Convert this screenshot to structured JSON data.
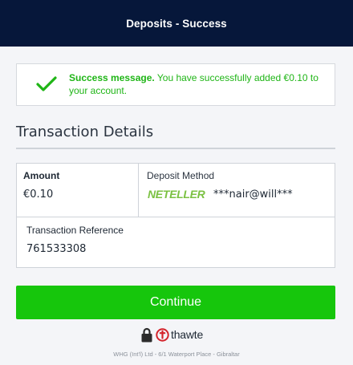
{
  "header": {
    "title": "Deposits - Success"
  },
  "success": {
    "lead": "Success message.",
    "message": " You have successfully added €0.10 to your account.",
    "icon": "check-icon",
    "color": "#1fb516"
  },
  "details": {
    "title": "Transaction Details",
    "amount_label": "Amount",
    "amount_value": "€0.10",
    "method_label": "Deposit Method",
    "method_logo": "NETELLER",
    "method_account": "***nair@will***",
    "ref_label": "Transaction Reference",
    "ref_value": "761533308"
  },
  "actions": {
    "continue_label": "Continue",
    "continue_color": "#16c60c"
  },
  "trust": {
    "lock_icon": "lock-icon",
    "brand": "thawte"
  },
  "footer": {
    "text": "WHG (Int'l) Ltd - 6/1 Waterport Place - Gibraltar"
  },
  "colors": {
    "header_bg": "#06173a",
    "page_bg": "#f4f5f8"
  }
}
